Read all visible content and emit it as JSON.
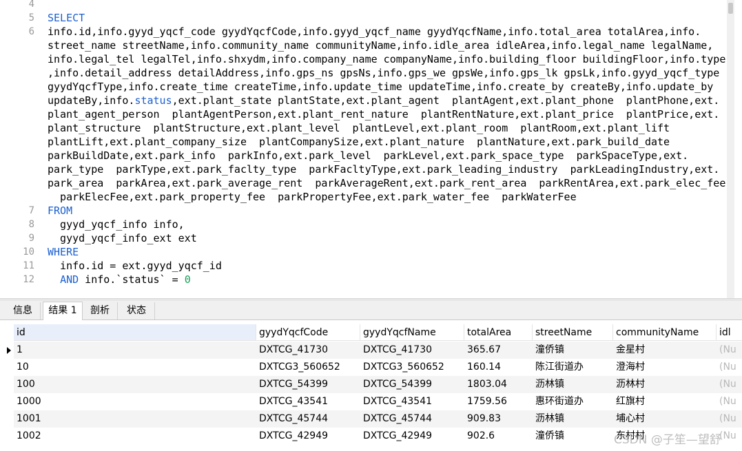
{
  "editor": {
    "lines": [
      {
        "n": "4",
        "segs": []
      },
      {
        "n": "5",
        "segs": [
          {
            "t": "SELECT",
            "c": "kw"
          }
        ]
      },
      {
        "n": "6",
        "segs": [
          {
            "t": "info.id,info.gyyd_yqcf_code gyydYqcfCode,info.gyyd_yqcf_name gyydYqcfName,info.total_area totalArea,info."
          }
        ]
      },
      {
        "n": "",
        "segs": [
          {
            "t": "street_name streetName,info.community_name communityName,info.idle_area idleArea,info.legal_name legalName,"
          }
        ]
      },
      {
        "n": "",
        "segs": [
          {
            "t": "info.legal_tel legalTel,info.shxydm,info.company_name companyName,info.building_floor buildingFloor,info.type"
          }
        ]
      },
      {
        "n": "",
        "segs": [
          {
            "t": ",info.detail_address detailAddress,info.gps_ns gpsNs,info.gps_we gpsWe,info.gps_lk gpsLk,info.gyyd_yqcf_type"
          }
        ]
      },
      {
        "n": "",
        "segs": [
          {
            "t": "gyydYqcfType,info.create_time createTime,info.update_time updateTime,info.create_by createBy,info.update_by"
          }
        ]
      },
      {
        "n": "",
        "segs": [
          {
            "t": "updateBy,info."
          },
          {
            "t": "status",
            "c": "kw"
          },
          {
            "t": ",ext.plant_state plantState,ext.plant_agent  plantAgent,ext.plant_phone  plantPhone,ext."
          }
        ]
      },
      {
        "n": "",
        "segs": [
          {
            "t": "plant_agent_person  plantAgentPerson,ext.plant_rent_nature  plantRentNature,ext.plant_price  plantPrice,ext."
          }
        ]
      },
      {
        "n": "",
        "segs": [
          {
            "t": "plant_structure  plantStructure,ext.plant_level  plantLevel,ext.plant_room  plantRoom,ext.plant_lift"
          }
        ]
      },
      {
        "n": "",
        "segs": [
          {
            "t": "plantLift,ext.plant_company_size  plantCompanySize,ext.plant_nature  plantNature,ext.park_build_date"
          }
        ]
      },
      {
        "n": "",
        "segs": [
          {
            "t": "parkBuildDate,ext.park_info  parkInfo,ext.park_level  parkLevel,ext.park_space_type  parkSpaceType,ext."
          }
        ]
      },
      {
        "n": "",
        "segs": [
          {
            "t": "park_type  parkType,ext.park_faclty_type  parkFacltyType,ext.park_leading_industry  parkLeadingIndustry,ext."
          }
        ]
      },
      {
        "n": "",
        "segs": [
          {
            "t": "park_area  parkArea,ext.park_average_rent  parkAverageRent,ext.park_rent_area  parkRentArea,ext.park_elec_fee"
          }
        ]
      },
      {
        "n": "",
        "segs": [
          {
            "t": "  parkElecFee,ext.park_property_fee  parkPropertyFee,ext.park_water_fee  parkWaterFee"
          }
        ]
      },
      {
        "n": "7",
        "segs": [
          {
            "t": "FROM",
            "c": "kw"
          }
        ]
      },
      {
        "n": "8",
        "segs": [
          {
            "t": "  gyyd_yqcf_info info,"
          }
        ]
      },
      {
        "n": "9",
        "segs": [
          {
            "t": "  gyyd_yqcf_info_ext ext"
          }
        ]
      },
      {
        "n": "10",
        "segs": [
          {
            "t": "WHERE",
            "c": "kw"
          }
        ]
      },
      {
        "n": "11",
        "segs": [
          {
            "t": "  info.id = ext.gyyd_yqcf_id"
          }
        ]
      },
      {
        "n": "12",
        "segs": [
          {
            "t": "  "
          },
          {
            "t": "AND",
            "c": "kw"
          },
          {
            "t": " info.`status` = "
          },
          {
            "t": "0",
            "c": "num"
          }
        ]
      }
    ]
  },
  "tabs": [
    {
      "label": "信息",
      "active": false
    },
    {
      "label": "结果 1",
      "active": true
    },
    {
      "label": "剖析",
      "active": false
    },
    {
      "label": "状态",
      "active": false
    }
  ],
  "grid": {
    "columns": [
      "id",
      "gyydYqcfCode",
      "gyydYqcfName",
      "totalArea",
      "streetName",
      "communityName",
      "idl"
    ],
    "rows": [
      [
        "1",
        "DXTCG_41730",
        "DXTCG_41730",
        "365.67",
        "潼侨镇",
        "金星村",
        "(Nu"
      ],
      [
        "10",
        "DXTCG3_560652",
        "DXTCG3_560652",
        "160.14",
        "陈江街道办",
        "澄海村",
        "(Nu"
      ],
      [
        "100",
        "DXTCG_54399",
        "DXTCG_54399",
        "1803.04",
        "沥林镇",
        "沥林村",
        "(Nu"
      ],
      [
        "1000",
        "DXTCG_43541",
        "DXTCG_43541",
        "1759.56",
        "惠环街道办",
        "红旗村",
        "(Nu"
      ],
      [
        "1001",
        "DXTCG_45744",
        "DXTCG_45744",
        "909.83",
        "沥林镇",
        "埔心村",
        "(Nu"
      ],
      [
        "1002",
        "DXTCG_42949",
        "DXTCG_42949",
        "902.6",
        "潼侨镇",
        "东村村",
        "(Nu"
      ]
    ],
    "selected_row": 0
  },
  "watermark": "CSDN @子笙—望舒"
}
